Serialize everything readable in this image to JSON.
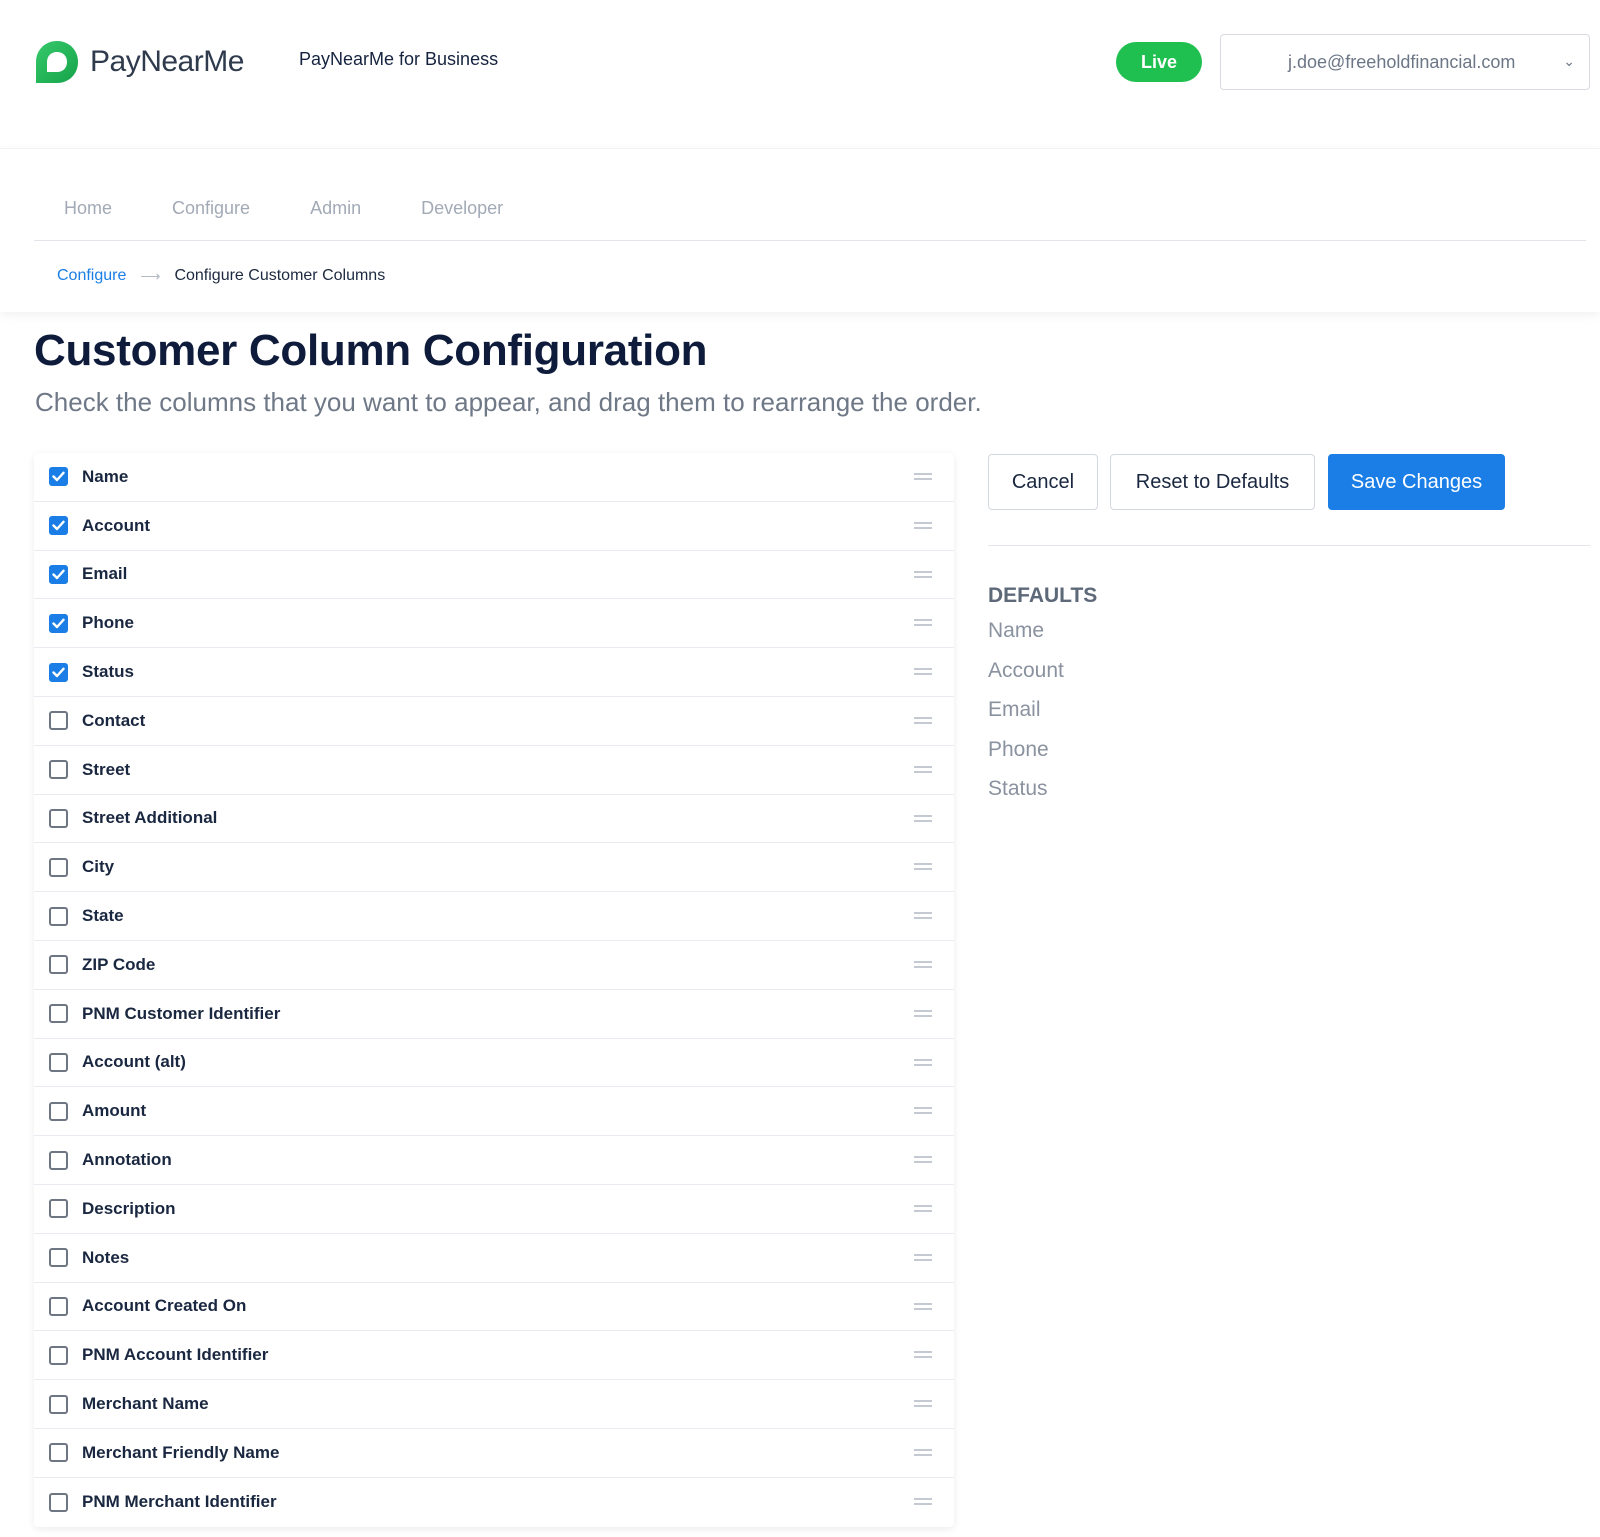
{
  "header": {
    "logo_text": "PayNearMe",
    "product_name": "PayNearMe for Business",
    "environment_badge": "Live",
    "user_email": "j.doe@freeholdfinancial.com",
    "brand_color": "#1fc04f"
  },
  "nav": {
    "tabs": [
      "Home",
      "Configure",
      "Admin",
      "Developer"
    ]
  },
  "breadcrumb": {
    "parent": "Configure",
    "current": "Configure Customer Columns"
  },
  "page": {
    "title": "Customer Column Configuration",
    "subtitle": "Check the columns that you want to appear, and drag them to rearrange the order."
  },
  "columns": [
    {
      "label": "Name",
      "checked": true
    },
    {
      "label": "Account",
      "checked": true
    },
    {
      "label": "Email",
      "checked": true
    },
    {
      "label": "Phone",
      "checked": true
    },
    {
      "label": "Status",
      "checked": true
    },
    {
      "label": "Contact",
      "checked": false
    },
    {
      "label": "Street",
      "checked": false
    },
    {
      "label": "Street Additional",
      "checked": false
    },
    {
      "label": "City",
      "checked": false
    },
    {
      "label": "State",
      "checked": false
    },
    {
      "label": "ZIP Code",
      "checked": false
    },
    {
      "label": "PNM Customer Identifier",
      "checked": false
    },
    {
      "label": "Account (alt)",
      "checked": false
    },
    {
      "label": "Amount",
      "checked": false
    },
    {
      "label": "Annotation",
      "checked": false
    },
    {
      "label": "Description",
      "checked": false
    },
    {
      "label": "Notes",
      "checked": false
    },
    {
      "label": "Account Created On",
      "checked": false
    },
    {
      "label": "PNM Account Identifier",
      "checked": false
    },
    {
      "label": "Merchant Name",
      "checked": false
    },
    {
      "label": "Merchant Friendly Name",
      "checked": false
    },
    {
      "label": "PNM Merchant Identifier",
      "checked": false
    }
  ],
  "actions": {
    "cancel_label": "Cancel",
    "reset_label": "Reset to Defaults",
    "save_label": "Save Changes",
    "primary_color": "#1a7ee6"
  },
  "defaults": {
    "heading": "DEFAULTS",
    "items": [
      "Name",
      "Account",
      "Email",
      "Phone",
      "Status"
    ]
  },
  "icons": {
    "checkbox_checked": "check-icon",
    "drag": "drag-handle-icon",
    "dropdown": "chevron-down-icon",
    "breadcrumb_separator": "arrow-right-icon"
  }
}
